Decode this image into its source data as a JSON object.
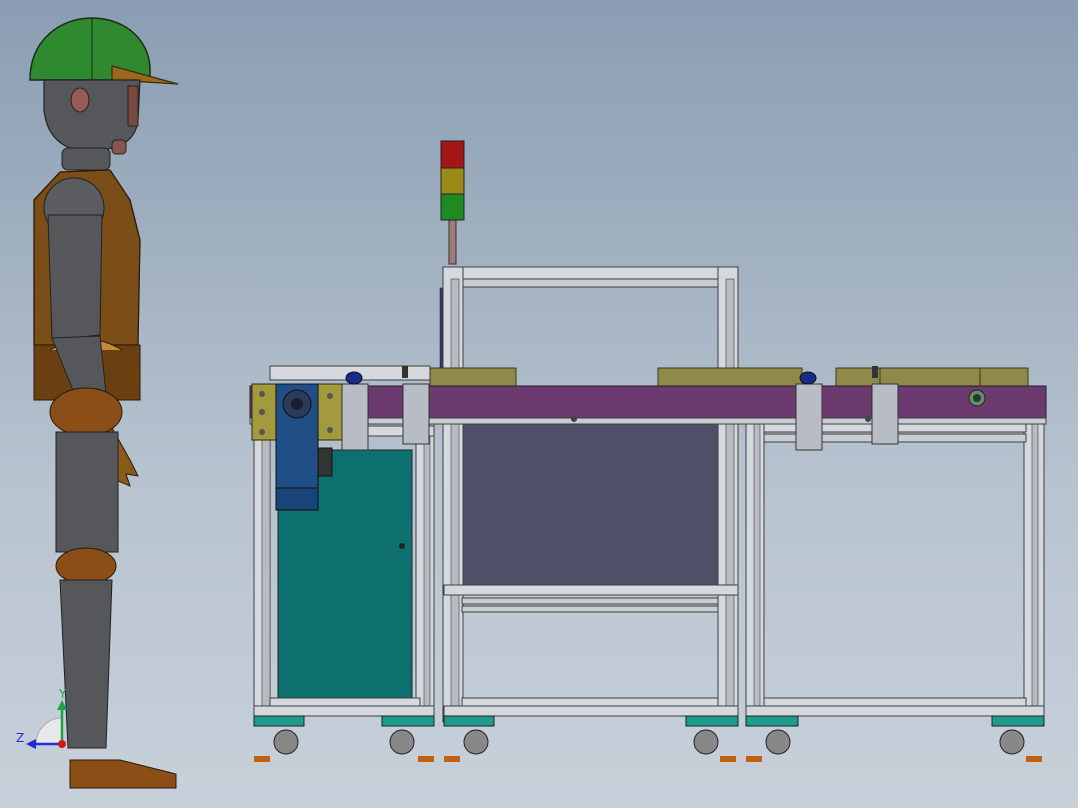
{
  "viewport": {
    "background_top": "#8a9db2",
    "background_bottom": "#c8d1da"
  },
  "triad": {
    "y_label": "Y",
    "z_label": "Z",
    "y_color": "#1aa34a",
    "z_color": "#1b2fd6",
    "x_color": "#d01818"
  },
  "colors": {
    "frame": "#d5d8dc",
    "frame_edge": "#3c3f44",
    "belt": "#6b3a6e",
    "cabinet_teal": "#0e6f6f",
    "panel_slate": "#4f5068",
    "motor_blue": "#1f4f86",
    "bracket_olive": "#a29a3c",
    "guard_olive": "#8f8a4a",
    "caster_base": "#1e9c8e",
    "light_red": "#a51616",
    "light_amber": "#9a8a16",
    "light_green": "#1f8a22",
    "helmet": "#2f8a2f",
    "vest": "#7a4e16",
    "mannequin_skin": "#55575b",
    "joint_wood": "#8a4e16"
  }
}
